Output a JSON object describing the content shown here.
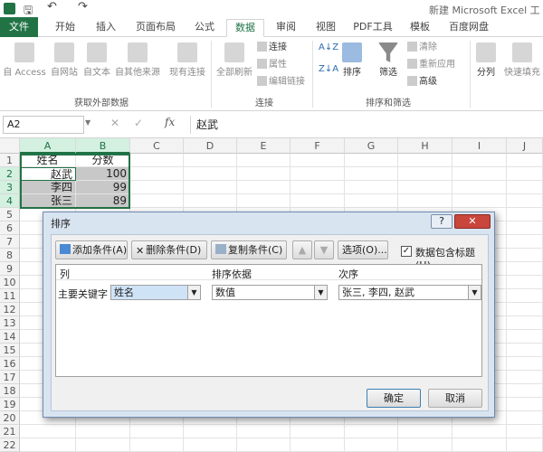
{
  "window": {
    "title": "新建 Microsoft Excel 工作表"
  },
  "ribbon_tabs": [
    "文件",
    "开始",
    "插入",
    "页面布局",
    "公式",
    "数据",
    "审阅",
    "视图",
    "PDF工具",
    "模板",
    "百度网盘"
  ],
  "ribbon": {
    "get_external": {
      "access": "自 Access",
      "web": "自网站",
      "text": "自文本",
      "other": "自其他来源",
      "existing": "现有连接",
      "label": "获取外部数据"
    },
    "connections": {
      "refresh": "全部刷新",
      "connections": "连接",
      "properties": "属性",
      "edit_links": "编辑链接",
      "label": "连接"
    },
    "sort_filter": {
      "sort": "排序",
      "filter": "筛选",
      "clear": "清除",
      "reapply": "重新应用",
      "advanced": "高级",
      "label": "排序和筛选"
    },
    "data_tools": {
      "split": "分列",
      "flash": "快速填充"
    }
  },
  "formula_bar": {
    "name_box": "A2",
    "fx": "fx",
    "content": "赵武"
  },
  "columns": [
    "A",
    "B",
    "C",
    "D",
    "E",
    "F",
    "G",
    "H",
    "I",
    "J"
  ],
  "rows": [
    "1",
    "2",
    "3",
    "4",
    "5",
    "6",
    "7",
    "8",
    "9",
    "10",
    "11",
    "12",
    "13",
    "14",
    "15",
    "16",
    "17",
    "18",
    "19",
    "20",
    "21",
    "22"
  ],
  "cells": {
    "a1": "姓名",
    "b1": "分数",
    "a2": "赵武",
    "b2": "100",
    "a3": "李四",
    "b3": "99",
    "a4": "张三",
    "b4": "89"
  },
  "dialog": {
    "title": "排序",
    "help": "?",
    "add_level": "添加条件(A)",
    "delete_level": "删除条件(D)",
    "copy_level": "复制条件(C)",
    "options": "选项(O)...",
    "header_checkbox": "数据包含标题(H)",
    "header_checked": "✓",
    "col_header": "列",
    "sort_on_header": "排序依据",
    "order_header": "次序",
    "sort_by_label": "主要关键字",
    "column_value": "姓名",
    "sort_on_value": "数值",
    "order_value": "张三, 李四, 赵武",
    "ok": "确定",
    "cancel": "取消"
  }
}
